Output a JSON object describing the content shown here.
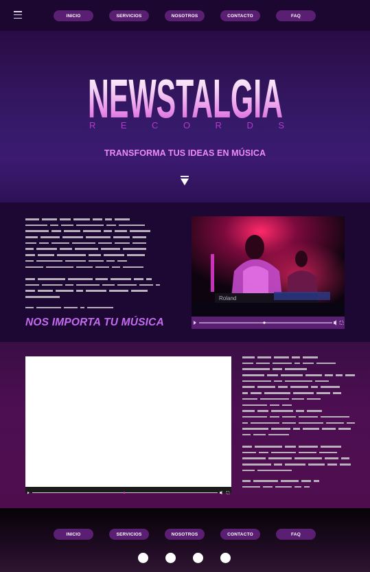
{
  "nav": {
    "items": [
      {
        "label": "INICIO"
      },
      {
        "label": "SERVICIOS"
      },
      {
        "label": "NOSOTROS"
      },
      {
        "label": "CONTACTO"
      },
      {
        "label": "FAQ"
      }
    ]
  },
  "hero": {
    "logo_main": "NEWSTALGIA",
    "logo_sub": "R E C O R D S",
    "tagline": "TRANSFORMA TUS IDEAS EN MÚSICA"
  },
  "section1": {
    "slogan": "NOS IMPORTA TU MÚSICA",
    "video_brand": "Roland"
  },
  "footer": {
    "social_count": 4
  },
  "colors": {
    "nav_bg": "#1c0730",
    "button": "#5a1f72",
    "accent": "#c56bf0",
    "tagline": "#ee8af5"
  }
}
